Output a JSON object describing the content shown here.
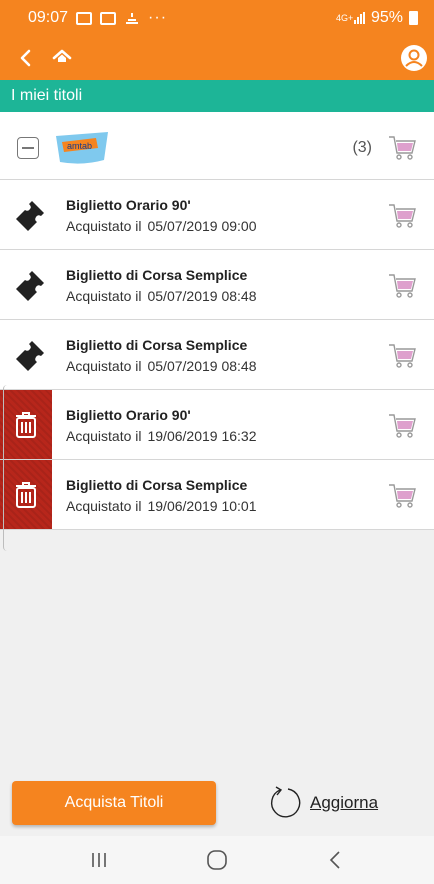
{
  "status_bar": {
    "time": "09:07",
    "overflow": "···",
    "network": "4G+",
    "battery": "95%"
  },
  "app_bar": {
    "back_icon": "chevron-left-icon",
    "home_icon": "home-icon",
    "user_icon": "user-avatar-icon"
  },
  "section": {
    "title": "I miei titoli"
  },
  "group": {
    "logo_icon": "amtab-logo",
    "logo_text": "amtab",
    "count": "(3)"
  },
  "tickets": [
    {
      "title": "Biglietto Orario 90'",
      "label": "Acquistato il",
      "date": "05/07/2019 09:00",
      "status": "valid"
    },
    {
      "title": "Biglietto di Corsa Semplice",
      "label": "Acquistato il",
      "date": "05/07/2019 08:48",
      "status": "valid"
    },
    {
      "title": "Biglietto di Corsa Semplice",
      "label": "Acquistato il",
      "date": "05/07/2019 08:48",
      "status": "valid"
    },
    {
      "title": "Biglietto Orario 90'",
      "label": "Acquistato il",
      "date": "19/06/2019 16:32",
      "status": "expired"
    },
    {
      "title": "Biglietto di Corsa Semplice",
      "label": "Acquistato il",
      "date": "19/06/2019 10:01",
      "status": "expired"
    }
  ],
  "actions": {
    "buy_label": "Acquista Titoli",
    "refresh_label": "Aggiorna"
  },
  "colors": {
    "brand_orange": "#f5841f",
    "header_teal": "#1db597",
    "delete_red": "#b7261b",
    "cart_pink": "#d88fc4"
  }
}
